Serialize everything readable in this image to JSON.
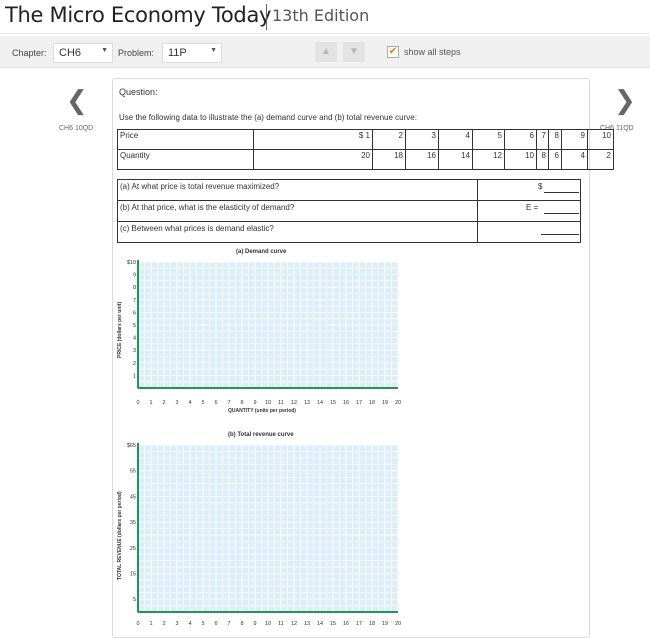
{
  "book": {
    "title": "The Micro Economy Today",
    "edition": "13th Edition"
  },
  "toolbar": {
    "chapter_label": "Chapter:",
    "chapter_value": "CH6",
    "problem_label": "Problem:",
    "problem_value": "11P",
    "prev_glyph": "▲",
    "next_glyph": "▼",
    "show_steps_checked": true,
    "show_steps_label": "show all steps",
    "accent_color": "#e07b00"
  },
  "nav": {
    "prev_glyph": "❮",
    "prev_label": "CH6 10QD",
    "next_glyph": "❯",
    "next_label": "CH6 11QD"
  },
  "question": {
    "heading": "Question:",
    "prompt": "Use the following data to illustrate the (a) demand curve and (b) total revenue curve:",
    "table": {
      "price_label": "Price",
      "price_values": [
        "$ 1",
        "2",
        "3",
        "4",
        "5",
        "6",
        "7",
        "8",
        "9",
        "10"
      ],
      "quantity_label": "Quantity",
      "quantity_values": [
        "20",
        "18",
        "16",
        "14",
        "12",
        "10",
        "8",
        "6",
        "4",
        "2"
      ]
    },
    "parts": [
      {
        "text": "(a) At what price is total revenue maximized?",
        "answer_prefix": "$"
      },
      {
        "text": "(b) At that price, what is the elasticity of demand?",
        "answer_prefix": "E ="
      },
      {
        "text": "(c) Between what prices is demand elastic?",
        "answer_prefix": ""
      }
    ]
  },
  "chart_data": [
    {
      "type": "scatter",
      "title": "(a) Demand curve",
      "xlabel": "QUANTITY (units per period)",
      "ylabel": "PRICE (dollars per unit)",
      "xlim": [
        0,
        20
      ],
      "ylim": [
        0,
        10
      ],
      "x_ticks": [
        "0",
        "1",
        "2",
        "3",
        "4",
        "5",
        "6",
        "7",
        "8",
        "9",
        "10",
        "11",
        "12",
        "13",
        "14",
        "15",
        "16",
        "17",
        "18",
        "19",
        "20"
      ],
      "y_ticks": [
        "$10",
        "9",
        "8",
        "7",
        "6",
        "5",
        "4",
        "3",
        "2",
        "1"
      ],
      "grid": true,
      "series": []
    },
    {
      "type": "scatter",
      "title": "(b) Total revenue curve",
      "xlabel": "",
      "ylabel": "TOTAL REVENUE (dollars per period)",
      "xlim": [
        0,
        20
      ],
      "ylim": [
        0,
        65
      ],
      "x_ticks": [
        "0",
        "1",
        "2",
        "3",
        "4",
        "5",
        "6",
        "7",
        "8",
        "9",
        "10",
        "11",
        "12",
        "13",
        "14",
        "15",
        "16",
        "17",
        "18",
        "19",
        "20"
      ],
      "y_ticks": [
        "$65",
        "55",
        "45",
        "35",
        "25",
        "15",
        "5"
      ],
      "grid": true,
      "series": []
    }
  ]
}
